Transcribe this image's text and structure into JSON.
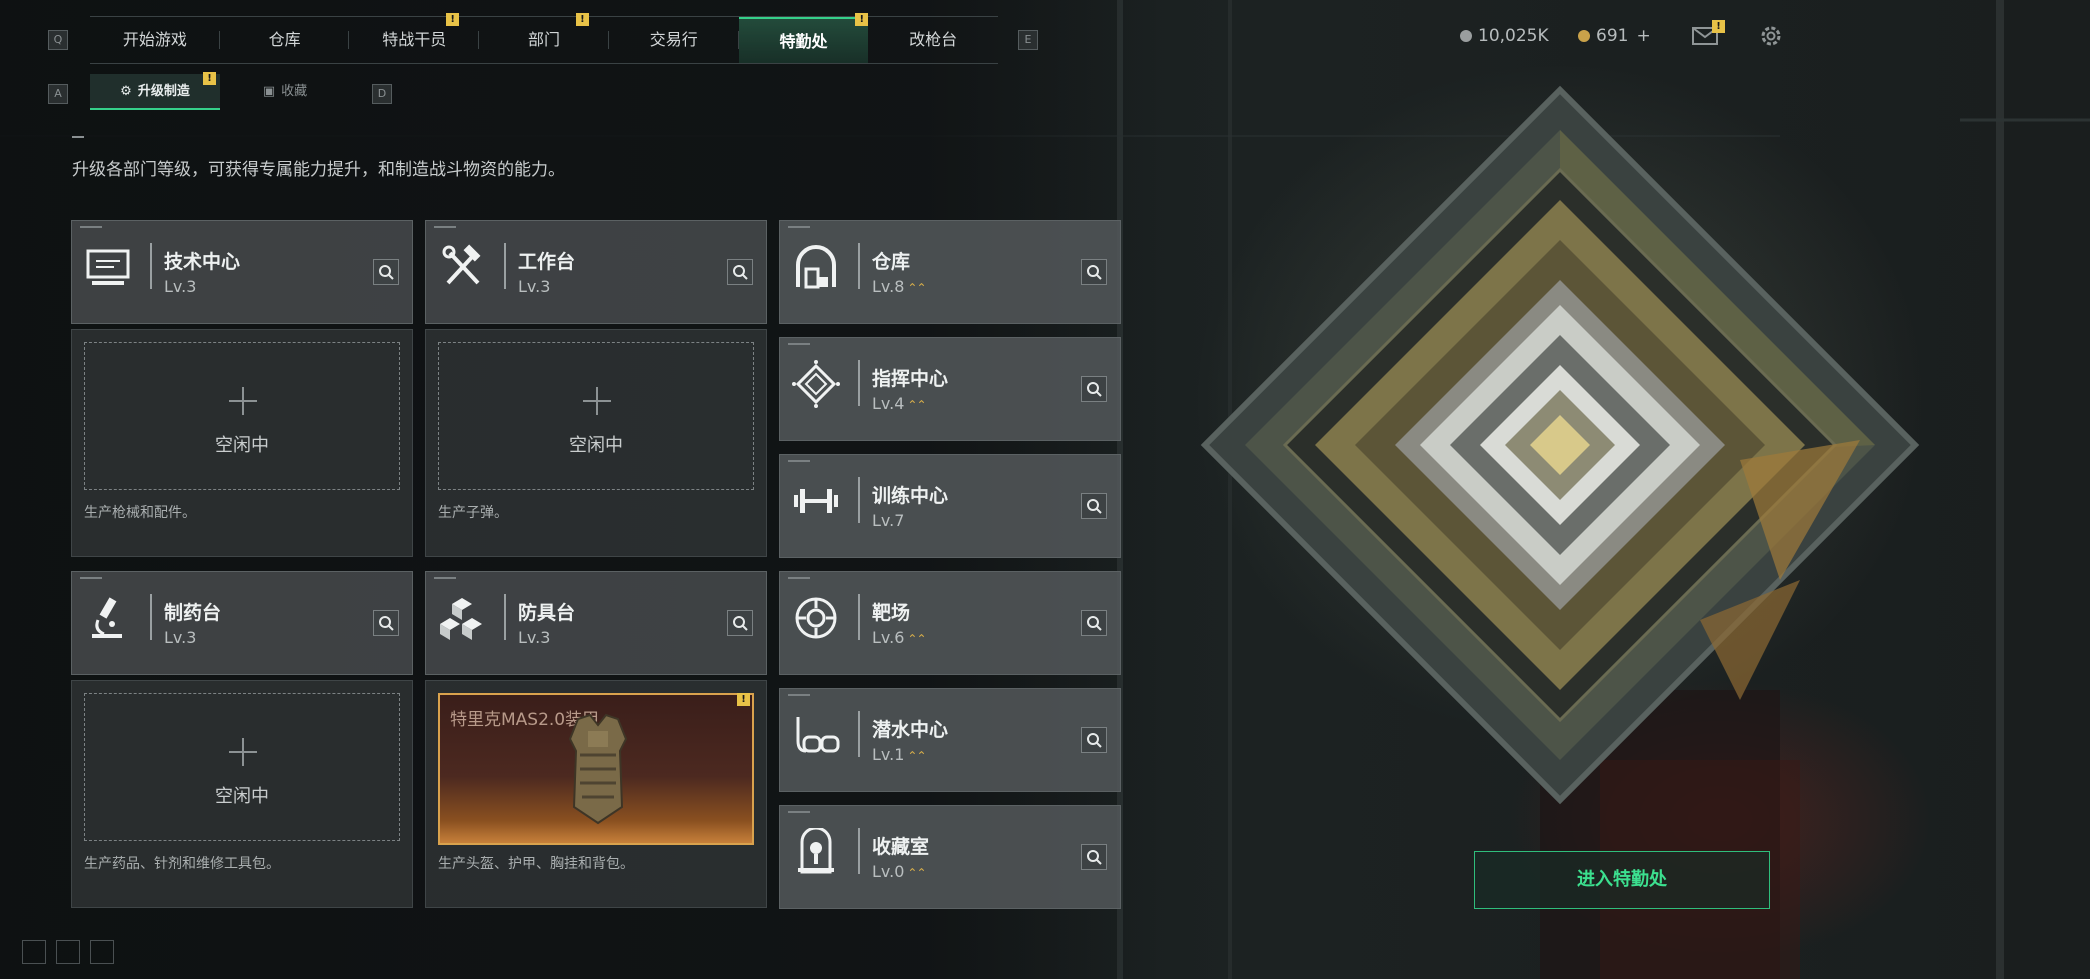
{
  "nav": {
    "left_key": "Q",
    "right_key": "E",
    "tabs": [
      {
        "label": "开始游戏",
        "badge": ""
      },
      {
        "label": "仓库",
        "badge": ""
      },
      {
        "label": "特战干员",
        "badge": "!"
      },
      {
        "label": "部门",
        "badge": "!"
      },
      {
        "label": "交易行",
        "badge": ""
      },
      {
        "label": "特勤处",
        "badge": "!",
        "active": true
      },
      {
        "label": "改枪台",
        "badge": ""
      }
    ]
  },
  "subnav": {
    "left_key": "A",
    "right_key": "D",
    "tabs": [
      {
        "label": "升级制造",
        "badge": "!",
        "active": true
      },
      {
        "label": "收藏",
        "badge": ""
      }
    ]
  },
  "resources": {
    "currency": "10,025K",
    "tokens": "691",
    "tokens_add": "+",
    "mail_badge": "!"
  },
  "intro": "升级各部门等级，可获得专属能力提升，和制造战斗物资的能力。",
  "idle_label": "空闲中",
  "production": [
    {
      "name": "技术中心",
      "level": "Lv.3",
      "icon": "computer-icon",
      "desc": "生产枪械和配件。",
      "state": "idle"
    },
    {
      "name": "工作台",
      "level": "Lv.3",
      "icon": "hammer-wrench-icon",
      "desc": "生产子弹。",
      "state": "idle"
    },
    {
      "name": "制药台",
      "level": "Lv.3",
      "icon": "microscope-icon",
      "desc": "生产药品、针剂和维修工具包。",
      "state": "idle"
    },
    {
      "name": "防具台",
      "level": "Lv.3",
      "icon": "armor-blocks-icon",
      "desc": "生产头盔、护甲、胸挂和背包。",
      "state": "crafting",
      "item": "特里克MAS2.0装甲",
      "badge": "!"
    }
  ],
  "facilities": [
    {
      "name": "仓库",
      "level": "Lv.8",
      "upgradable": true,
      "icon": "warehouse-icon"
    },
    {
      "name": "指挥中心",
      "level": "Lv.4",
      "upgradable": true,
      "icon": "command-diamond-icon"
    },
    {
      "name": "训练中心",
      "level": "Lv.7",
      "upgradable": false,
      "icon": "dumbbell-icon"
    },
    {
      "name": "靶场",
      "level": "Lv.6",
      "upgradable": true,
      "icon": "target-icon"
    },
    {
      "name": "潜水中心",
      "level": "Lv.1",
      "upgradable": true,
      "icon": "diving-mask-icon"
    },
    {
      "name": "收藏室",
      "level": "Lv.0",
      "upgradable": true,
      "icon": "trophy-case-icon"
    }
  ],
  "upgrade_glyph": "⌃⌃",
  "enter_button": "进入特勤处",
  "colors": {
    "accent": "#35d08a",
    "badge": "#e8c247",
    "upgrade": "#d6ad4a"
  }
}
